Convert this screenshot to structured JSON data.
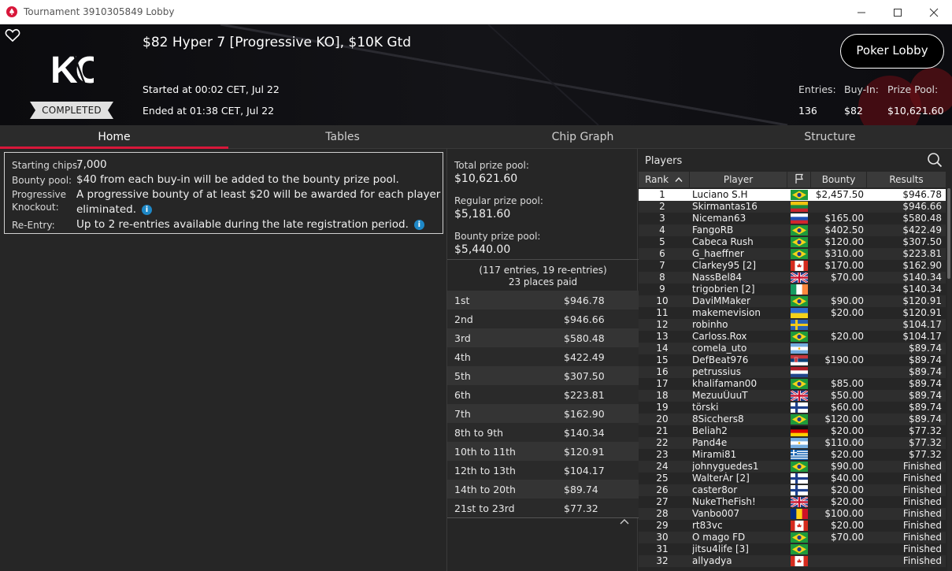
{
  "window": {
    "title": "Tournament 3910305849 Lobby",
    "logo_icon": "pokerstars-spade-icon",
    "controls": [
      "minimize-icon",
      "maximize-icon",
      "close-icon"
    ]
  },
  "header": {
    "tournament_name": "$82 Hyper 7 [Progressive KO], $10K Gtd",
    "status": "COMPLETED",
    "started": "Started at 00:02 CET, Jul 22",
    "ended": "Ended at 01:38 CET, Jul 22",
    "lobby_button": "Poker Lobby",
    "entries_label": "Entries:",
    "entries_value": "136",
    "buyin_label": "Buy-In:",
    "buyin_value": "$82",
    "prizepool_label": "Prize Pool:",
    "prizepool_value": "$10,621.60"
  },
  "tabs": [
    {
      "label": "Home",
      "active": true
    },
    {
      "label": "Tables",
      "active": false
    },
    {
      "label": "Chip Graph",
      "active": false
    },
    {
      "label": "Structure",
      "active": false
    }
  ],
  "info": {
    "starting_chips_label": "Starting chips:",
    "starting_chips_value": "7,000",
    "bounty_pool_label": "Bounty pool:",
    "bounty_pool_value": "$40 from each buy-in will be added to the bounty prize pool.",
    "progressive_label_1": "Progressive",
    "progressive_label_2": "Knockout:",
    "progressive_value_1": "A progressive bounty of at least $20 will be awarded for each player",
    "progressive_value_2": "eliminated.",
    "reentry_label": "Re-Entry:",
    "reentry_value": "Up to 2 re-entries available during the late registration period.",
    "info_icon_glyph": "i"
  },
  "prize": {
    "total_label": "Total prize pool:",
    "total_value": "$10,621.60",
    "regular_label": "Regular prize pool:",
    "regular_value": "$5,181.60",
    "bounty_label": "Bounty prize pool:",
    "bounty_value": "$5,440.00",
    "summary_line1": "(117 entries, 19 re-entries)",
    "summary_line2": "23 places paid",
    "payouts": [
      {
        "place": "1st",
        "amount": "$946.78"
      },
      {
        "place": "2nd",
        "amount": "$946.66"
      },
      {
        "place": "3rd",
        "amount": "$580.48"
      },
      {
        "place": "4th",
        "amount": "$422.49"
      },
      {
        "place": "5th",
        "amount": "$307.50"
      },
      {
        "place": "6th",
        "amount": "$223.81"
      },
      {
        "place": "7th",
        "amount": "$162.90"
      },
      {
        "place": "8th to 9th",
        "amount": "$140.34"
      },
      {
        "place": "10th to 11th",
        "amount": "$120.91"
      },
      {
        "place": "12th to 13th",
        "amount": "$104.17"
      },
      {
        "place": "14th to 20th",
        "amount": "$89.74"
      },
      {
        "place": "21st to 23rd",
        "amount": "$77.32"
      }
    ]
  },
  "players": {
    "title": "Players",
    "columns": {
      "rank": "Rank",
      "player": "Player",
      "bounty": "Bounty",
      "results": "Results"
    },
    "rows": [
      {
        "rank": "1",
        "name": "Luciano S.H",
        "flag": "br",
        "bounty": "$2,457.50",
        "result": "$946.78"
      },
      {
        "rank": "2",
        "name": "Skirmantas16",
        "flag": "lt",
        "bounty": "",
        "result": "$946.66"
      },
      {
        "rank": "3",
        "name": "Niceman63",
        "flag": "ru",
        "bounty": "$165.00",
        "result": "$580.48"
      },
      {
        "rank": "4",
        "name": "FangoRB",
        "flag": "br",
        "bounty": "$402.50",
        "result": "$422.49"
      },
      {
        "rank": "5",
        "name": "Cabeca Rush",
        "flag": "br",
        "bounty": "$120.00",
        "result": "$307.50"
      },
      {
        "rank": "6",
        "name": "G_haeffner",
        "flag": "br",
        "bounty": "$310.00",
        "result": "$223.81"
      },
      {
        "rank": "7",
        "name": "Clarkey95 [2]",
        "flag": "ca",
        "bounty": "$170.00",
        "result": "$162.90"
      },
      {
        "rank": "8",
        "name": "NassBel84",
        "flag": "gb",
        "bounty": "$70.00",
        "result": "$140.34"
      },
      {
        "rank": "9",
        "name": "trigobrien [2]",
        "flag": "ie",
        "bounty": "",
        "result": "$140.34"
      },
      {
        "rank": "10",
        "name": "DaviMMaker",
        "flag": "br",
        "bounty": "$90.00",
        "result": "$120.91"
      },
      {
        "rank": "11",
        "name": "makemevision",
        "flag": "ua",
        "bounty": "$20.00",
        "result": "$120.91"
      },
      {
        "rank": "12",
        "name": "robinho",
        "flag": "se",
        "bounty": "",
        "result": "$104.17"
      },
      {
        "rank": "13",
        "name": "Carloss.Rox",
        "flag": "br",
        "bounty": "$20.00",
        "result": "$104.17"
      },
      {
        "rank": "14",
        "name": "comela_uto",
        "flag": "ar",
        "bounty": "",
        "result": "$89.74"
      },
      {
        "rank": "15",
        "name": "DefBeat976",
        "flag": "rs",
        "bounty": "$190.00",
        "result": "$89.74"
      },
      {
        "rank": "16",
        "name": "petrussius",
        "flag": "nl",
        "bounty": "",
        "result": "$89.74"
      },
      {
        "rank": "17",
        "name": "khalifaman00",
        "flag": "br",
        "bounty": "$85.00",
        "result": "$89.74"
      },
      {
        "rank": "18",
        "name": "MezuuÛuuT",
        "flag": "gb",
        "bounty": "$50.00",
        "result": "$89.74"
      },
      {
        "rank": "19",
        "name": "törski",
        "flag": "fi",
        "bounty": "$60.00",
        "result": "$89.74"
      },
      {
        "rank": "20",
        "name": "8Sicchers8",
        "flag": "br",
        "bounty": "$120.00",
        "result": "$89.74"
      },
      {
        "rank": "21",
        "name": "Beliah2",
        "flag": "de",
        "bounty": "$20.00",
        "result": "$77.32"
      },
      {
        "rank": "22",
        "name": "Pand4e",
        "flag": "ar",
        "bounty": "$110.00",
        "result": "$77.32"
      },
      {
        "rank": "23",
        "name": "Mirami81",
        "flag": "gr",
        "bounty": "$20.00",
        "result": "$77.32"
      },
      {
        "rank": "24",
        "name": "johnyguedes1",
        "flag": "br",
        "bounty": "$90.00",
        "result": "Finished"
      },
      {
        "rank": "25",
        "name": "WalterÀr [2]",
        "flag": "fi",
        "bounty": "$40.00",
        "result": "Finished"
      },
      {
        "rank": "26",
        "name": "caster8or",
        "flag": "fi",
        "bounty": "$20.00",
        "result": "Finished"
      },
      {
        "rank": "27",
        "name": "NukeTheFish!",
        "flag": "gb",
        "bounty": "$20.00",
        "result": "Finished"
      },
      {
        "rank": "28",
        "name": "Vanbo007",
        "flag": "ro",
        "bounty": "$100.00",
        "result": "Finished"
      },
      {
        "rank": "29",
        "name": "rt83vc",
        "flag": "ca",
        "bounty": "$20.00",
        "result": "Finished"
      },
      {
        "rank": "30",
        "name": "O mago FD",
        "flag": "br",
        "bounty": "$70.00",
        "result": "Finished"
      },
      {
        "rank": "31",
        "name": "jitsu4life [3]",
        "flag": "br",
        "bounty": "",
        "result": "Finished"
      },
      {
        "rank": "32",
        "name": "allyadya",
        "flag": "ca",
        "bounty": "",
        "result": "Finished"
      }
    ]
  },
  "colors": {
    "accent_red": "#d8173a",
    "info_blue": "#1e88c7",
    "panel_bg": "#262626"
  }
}
